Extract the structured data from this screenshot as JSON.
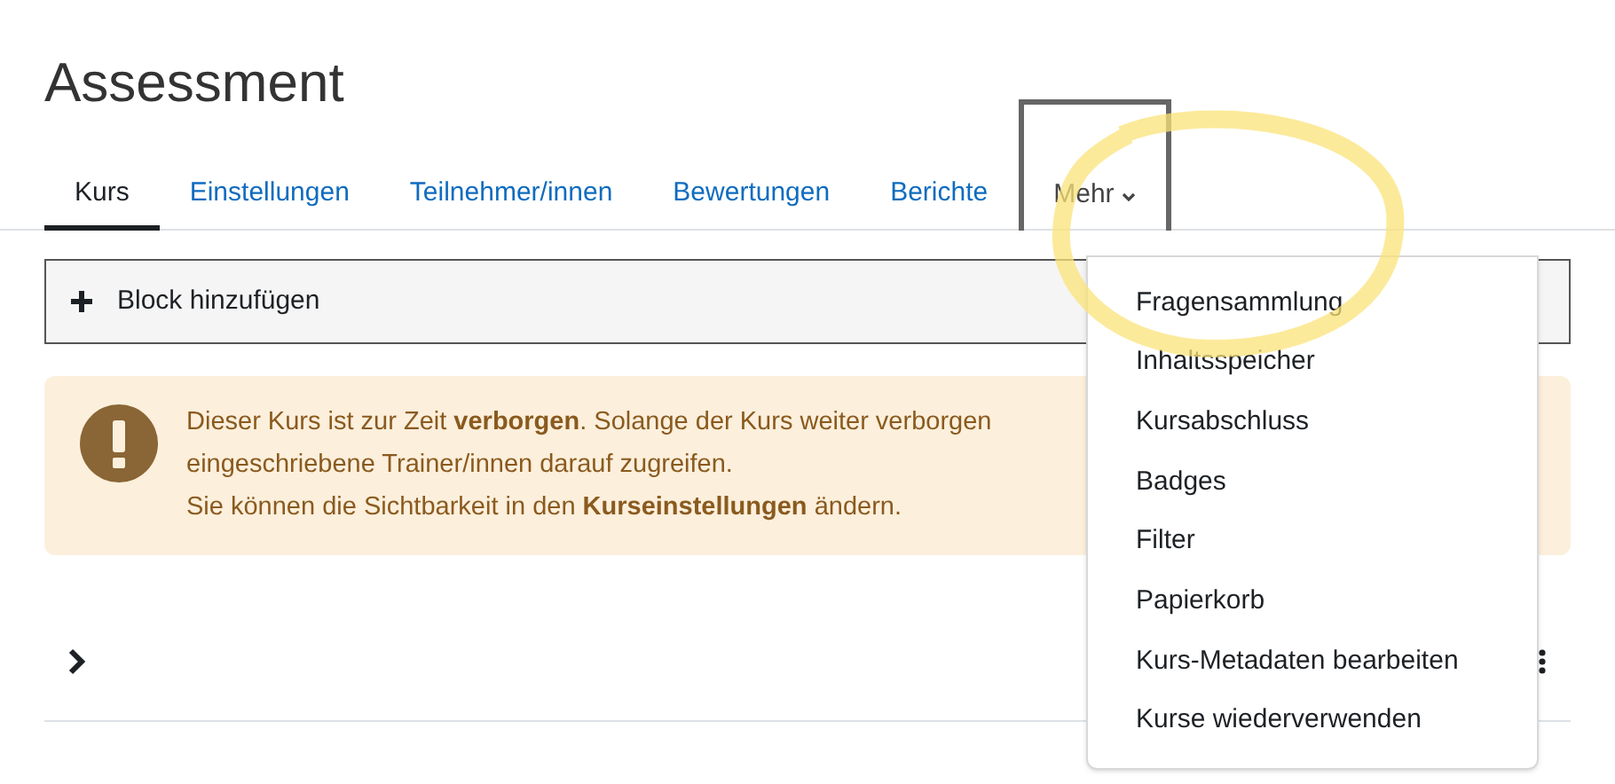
{
  "title": "Assessment",
  "tabs": [
    {
      "label": "Kurs",
      "selected": true
    },
    {
      "label": "Einstellungen",
      "selected": false
    },
    {
      "label": "Teilnehmer/innen",
      "selected": false
    },
    {
      "label": "Bewertungen",
      "selected": false
    },
    {
      "label": "Berichte",
      "selected": false
    },
    {
      "label": "Mehr",
      "selected": false,
      "focused": true,
      "expanded": true
    }
  ],
  "add_block": {
    "label": "Block hinzufügen"
  },
  "alert": {
    "lines": [
      "Dieser Kurs ist zur Zeit **verborgen**. Solange der Kurs weiter verborgen",
      "eingeschriebene Trainer/innen darauf zugreifen.",
      "Sie können die Sichtbarkeit in den **Kurseinstellungen** ändern."
    ]
  },
  "more_menu": [
    "Fragensammlung",
    "Inhaltsspeicher",
    "Kursabschluss",
    "Badges",
    "Filter",
    "Papierkorb",
    "Kurs-Metadaten bearbeiten",
    "Kurse wiederverwenden"
  ]
}
